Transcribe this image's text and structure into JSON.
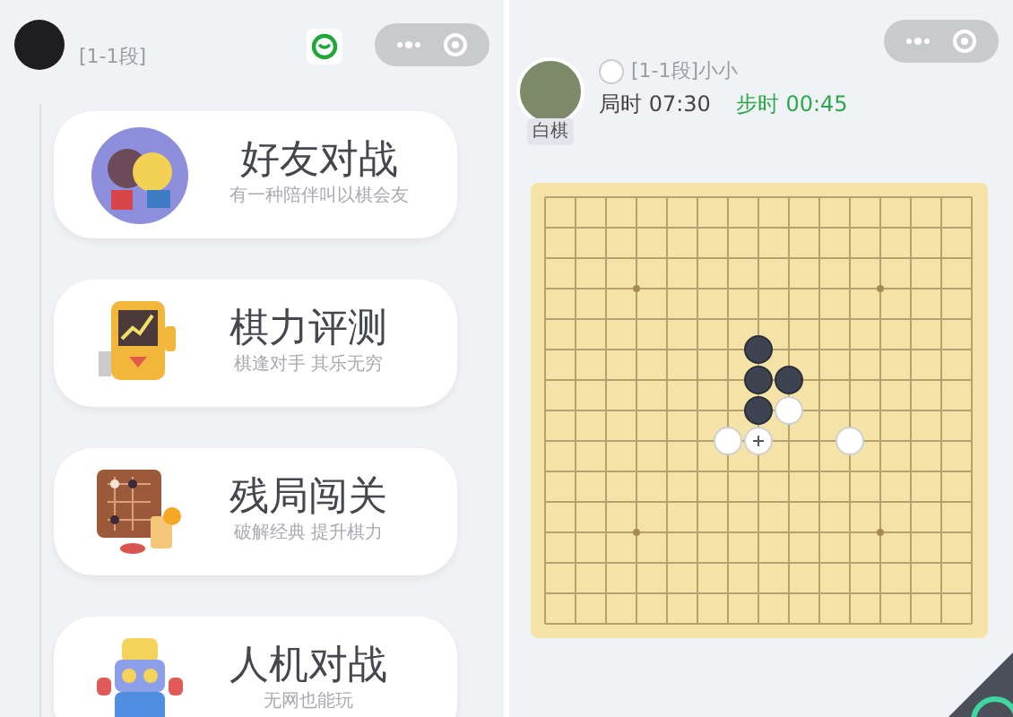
{
  "left_screen": {
    "profile": {
      "rank": "[1-1段]"
    },
    "modes": [
      {
        "title": "好友对战",
        "subtitle": "有一种陪伴叫以棋会友",
        "kind": "friends"
      },
      {
        "title": "棋力评测",
        "subtitle": "棋逢对手 其乐无穷",
        "kind": "test"
      },
      {
        "title": "残局闯关",
        "subtitle": "破解经典 提升棋力",
        "kind": "puzzle"
      },
      {
        "title": "人机对战",
        "subtitle": "无网也能玩",
        "kind": "robot"
      }
    ]
  },
  "right_screen": {
    "player": {
      "side": "白棋",
      "name": "[1-1段]小小",
      "game_time": "局时 07:30",
      "move_time": "步时 00:45"
    },
    "board": {
      "rows": [
        [
          {
            "kind": "empty"
          },
          {
            "kind": "empty"
          },
          {
            "kind": "empty"
          },
          {
            "kind": "empty"
          },
          {
            "kind": "empty"
          },
          {
            "kind": "empty"
          },
          {
            "kind": "empty"
          },
          {
            "kind": "empty"
          },
          {
            "kind": "empty"
          },
          {
            "kind": "empty"
          },
          {
            "kind": "empty"
          },
          {
            "kind": "empty"
          },
          {
            "kind": "empty"
          },
          {
            "kind": "empty"
          },
          {
            "kind": "empty"
          }
        ],
        [
          {
            "kind": "empty"
          },
          {
            "kind": "empty"
          },
          {
            "kind": "empty"
          },
          {
            "kind": "empty"
          },
          {
            "kind": "empty"
          },
          {
            "kind": "empty"
          },
          {
            "kind": "empty"
          },
          {
            "kind": "empty"
          },
          {
            "kind": "empty"
          },
          {
            "kind": "empty"
          },
          {
            "kind": "empty"
          },
          {
            "kind": "empty"
          },
          {
            "kind": "empty"
          },
          {
            "kind": "empty"
          },
          {
            "kind": "empty"
          }
        ],
        [
          {
            "kind": "empty"
          },
          {
            "kind": "empty"
          },
          {
            "kind": "empty"
          },
          {
            "kind": "empty"
          },
          {
            "kind": "empty"
          },
          {
            "kind": "empty"
          },
          {
            "kind": "empty"
          },
          {
            "kind": "empty"
          },
          {
            "kind": "empty"
          },
          {
            "kind": "empty"
          },
          {
            "kind": "empty"
          },
          {
            "kind": "empty"
          },
          {
            "kind": "empty"
          },
          {
            "kind": "empty"
          },
          {
            "kind": "empty"
          }
        ],
        [
          {
            "kind": "empty"
          },
          {
            "kind": "empty"
          },
          {
            "kind": "empty"
          },
          {
            "kind": "empty"
          },
          {
            "kind": "empty"
          },
          {
            "kind": "empty"
          },
          {
            "kind": "empty"
          },
          {
            "kind": "empty"
          },
          {
            "kind": "empty"
          },
          {
            "kind": "empty"
          },
          {
            "kind": "empty"
          },
          {
            "kind": "empty"
          },
          {
            "kind": "empty"
          },
          {
            "kind": "empty"
          },
          {
            "kind": "empty"
          }
        ],
        [
          {
            "kind": "empty"
          },
          {
            "kind": "empty"
          },
          {
            "kind": "empty"
          },
          {
            "kind": "empty"
          },
          {
            "kind": "empty"
          },
          {
            "kind": "empty"
          },
          {
            "kind": "empty"
          },
          {
            "kind": "empty"
          },
          {
            "kind": "empty"
          },
          {
            "kind": "empty"
          },
          {
            "kind": "empty"
          },
          {
            "kind": "empty"
          },
          {
            "kind": "empty"
          },
          {
            "kind": "empty"
          },
          {
            "kind": "empty"
          }
        ],
        [
          {
            "kind": "empty"
          },
          {
            "kind": "empty"
          },
          {
            "kind": "empty"
          },
          {
            "kind": "empty"
          },
          {
            "kind": "empty"
          },
          {
            "kind": "empty"
          },
          {
            "kind": "empty"
          },
          {
            "kind": "black"
          },
          {
            "kind": "empty"
          },
          {
            "kind": "empty"
          },
          {
            "kind": "empty"
          },
          {
            "kind": "empty"
          },
          {
            "kind": "empty"
          },
          {
            "kind": "empty"
          },
          {
            "kind": "empty"
          }
        ],
        [
          {
            "kind": "empty"
          },
          {
            "kind": "empty"
          },
          {
            "kind": "empty"
          },
          {
            "kind": "empty"
          },
          {
            "kind": "empty"
          },
          {
            "kind": "empty"
          },
          {
            "kind": "empty"
          },
          {
            "kind": "black"
          },
          {
            "kind": "black"
          },
          {
            "kind": "empty"
          },
          {
            "kind": "empty"
          },
          {
            "kind": "empty"
          },
          {
            "kind": "empty"
          },
          {
            "kind": "empty"
          },
          {
            "kind": "empty"
          }
        ],
        [
          {
            "kind": "empty"
          },
          {
            "kind": "empty"
          },
          {
            "kind": "empty"
          },
          {
            "kind": "empty"
          },
          {
            "kind": "empty"
          },
          {
            "kind": "empty"
          },
          {
            "kind": "empty"
          },
          {
            "kind": "black"
          },
          {
            "kind": "white"
          },
          {
            "kind": "empty"
          },
          {
            "kind": "empty"
          },
          {
            "kind": "empty"
          },
          {
            "kind": "empty"
          },
          {
            "kind": "empty"
          },
          {
            "kind": "empty"
          }
        ],
        [
          {
            "kind": "empty"
          },
          {
            "kind": "empty"
          },
          {
            "kind": "empty"
          },
          {
            "kind": "empty"
          },
          {
            "kind": "empty"
          },
          {
            "kind": "empty"
          },
          {
            "kind": "white"
          },
          {
            "kind": "marked"
          },
          {
            "kind": "empty"
          },
          {
            "kind": "empty"
          },
          {
            "kind": "white"
          },
          {
            "kind": "empty"
          },
          {
            "kind": "empty"
          },
          {
            "kind": "empty"
          },
          {
            "kind": "empty"
          }
        ],
        [
          {
            "kind": "empty"
          },
          {
            "kind": "empty"
          },
          {
            "kind": "empty"
          },
          {
            "kind": "empty"
          },
          {
            "kind": "empty"
          },
          {
            "kind": "empty"
          },
          {
            "kind": "empty"
          },
          {
            "kind": "empty"
          },
          {
            "kind": "empty"
          },
          {
            "kind": "empty"
          },
          {
            "kind": "empty"
          },
          {
            "kind": "empty"
          },
          {
            "kind": "empty"
          },
          {
            "kind": "empty"
          },
          {
            "kind": "empty"
          }
        ],
        [
          {
            "kind": "empty"
          },
          {
            "kind": "empty"
          },
          {
            "kind": "empty"
          },
          {
            "kind": "empty"
          },
          {
            "kind": "empty"
          },
          {
            "kind": "empty"
          },
          {
            "kind": "empty"
          },
          {
            "kind": "empty"
          },
          {
            "kind": "empty"
          },
          {
            "kind": "empty"
          },
          {
            "kind": "empty"
          },
          {
            "kind": "empty"
          },
          {
            "kind": "empty"
          },
          {
            "kind": "empty"
          },
          {
            "kind": "empty"
          }
        ],
        [
          {
            "kind": "empty"
          },
          {
            "kind": "empty"
          },
          {
            "kind": "empty"
          },
          {
            "kind": "empty"
          },
          {
            "kind": "empty"
          },
          {
            "kind": "empty"
          },
          {
            "kind": "empty"
          },
          {
            "kind": "empty"
          },
          {
            "kind": "empty"
          },
          {
            "kind": "empty"
          },
          {
            "kind": "empty"
          },
          {
            "kind": "empty"
          },
          {
            "kind": "empty"
          },
          {
            "kind": "empty"
          },
          {
            "kind": "empty"
          }
        ],
        [
          {
            "kind": "empty"
          },
          {
            "kind": "empty"
          },
          {
            "kind": "empty"
          },
          {
            "kind": "empty"
          },
          {
            "kind": "empty"
          },
          {
            "kind": "empty"
          },
          {
            "kind": "empty"
          },
          {
            "kind": "empty"
          },
          {
            "kind": "empty"
          },
          {
            "kind": "empty"
          },
          {
            "kind": "empty"
          },
          {
            "kind": "empty"
          },
          {
            "kind": "empty"
          },
          {
            "kind": "empty"
          },
          {
            "kind": "empty"
          }
        ],
        [
          {
            "kind": "empty"
          },
          {
            "kind": "empty"
          },
          {
            "kind": "empty"
          },
          {
            "kind": "empty"
          },
          {
            "kind": "empty"
          },
          {
            "kind": "empty"
          },
          {
            "kind": "empty"
          },
          {
            "kind": "empty"
          },
          {
            "kind": "empty"
          },
          {
            "kind": "empty"
          },
          {
            "kind": "empty"
          },
          {
            "kind": "empty"
          },
          {
            "kind": "empty"
          },
          {
            "kind": "empty"
          },
          {
            "kind": "empty"
          }
        ],
        [
          {
            "kind": "empty"
          },
          {
            "kind": "empty"
          },
          {
            "kind": "empty"
          },
          {
            "kind": "empty"
          },
          {
            "kind": "empty"
          },
          {
            "kind": "empty"
          },
          {
            "kind": "empty"
          },
          {
            "kind": "empty"
          },
          {
            "kind": "empty"
          },
          {
            "kind": "empty"
          },
          {
            "kind": "empty"
          },
          {
            "kind": "empty"
          },
          {
            "kind": "empty"
          },
          {
            "kind": "empty"
          },
          {
            "kind": "empty"
          }
        ]
      ]
    }
  }
}
